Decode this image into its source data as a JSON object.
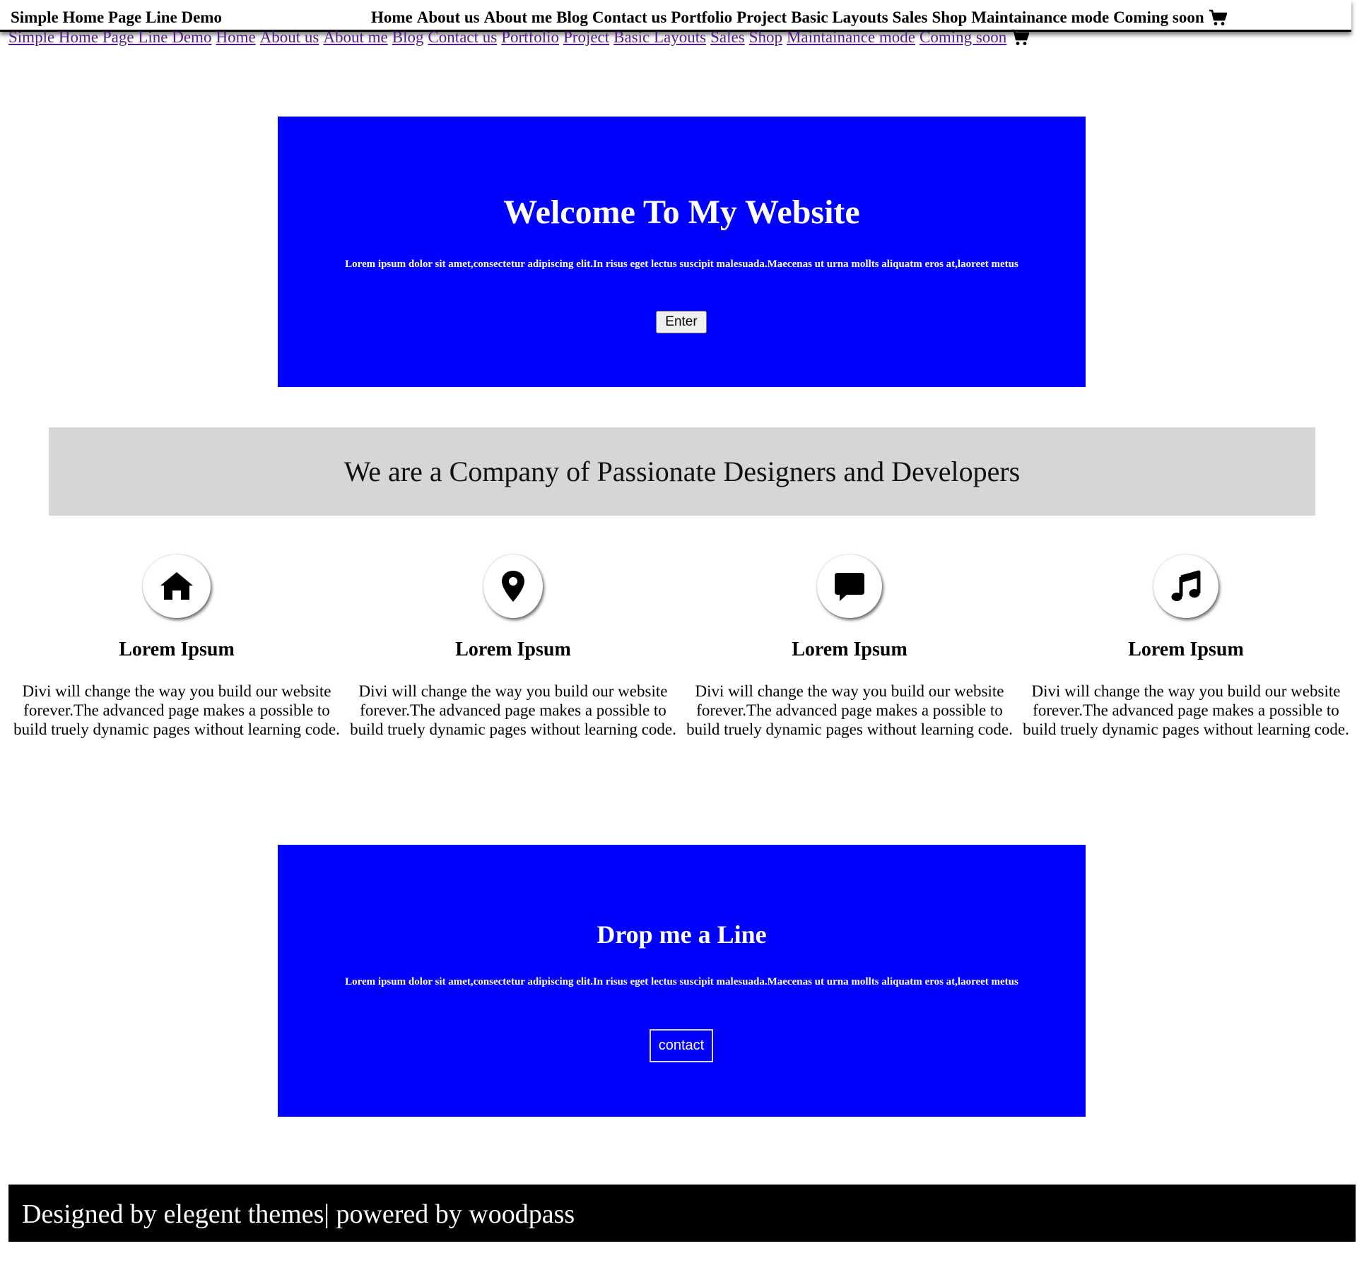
{
  "header": {
    "brand": "Simple Home Page Line Demo",
    "menu": [
      "Home",
      "About us",
      "About me",
      "Blog",
      "Contact us",
      "Portfolio",
      "Project",
      "Basic Layouts",
      "Sales",
      "Shop",
      "Maintainance mode",
      "Coming soon"
    ],
    "cart_icon": "cart-icon"
  },
  "linkrow": {
    "brand": "Simple Home Page Line Demo",
    "links": [
      "Home",
      "About us",
      "About me",
      "Blog",
      "Contact us",
      "Portfolio",
      "Project",
      "Basic Layouts",
      "Sales",
      "Shop",
      "Maintainance mode",
      "Coming soon"
    ],
    "cart_icon": "cart-icon"
  },
  "hero": {
    "title": "Welcome To My Website",
    "text": "Lorem ipsum dolor sit amet,consectetur adipiscing elit.In risus eget lectus suscipit malesuada.Maecenas ut urna mollts aliquatm eros at,laoreet metus",
    "button": "Enter",
    "background": "#0000ff"
  },
  "banner": {
    "title": "We are a Company of Passionate Designers and Developers",
    "background": "#d6d6d4"
  },
  "features": [
    {
      "icon": "home-icon",
      "title": "Lorem Ipsum",
      "text": "Divi will change the way you build our website forever.The advanced page makes a possible to build truely dynamic pages without learning code."
    },
    {
      "icon": "location-pin-icon",
      "title": "Lorem Ipsum",
      "text": "Divi will change the way you build our website forever.The advanced page makes a possible to build truely dynamic pages without learning code."
    },
    {
      "icon": "chat-bubble-icon",
      "title": "Lorem Ipsum",
      "text": "Divi will change the way you build our website forever.The advanced page makes a possible to build truely dynamic pages without learning code."
    },
    {
      "icon": "music-note-icon",
      "title": "Lorem Ipsum",
      "text": "Divi will change the way you build our website forever.The advanced page makes a possible to build truely dynamic pages without learning code."
    }
  ],
  "contact": {
    "title": "Drop me a Line",
    "text": "Lorem ipsum dolor sit amet,consectetur adipiscing elit.In risus eget lectus suscipit malesuada.Maecenas ut urna mollts aliquatm eros at,laoreet metus",
    "button": "contact"
  },
  "footer": {
    "text": "Designed by elegent themes| powered by woodpass",
    "background": "#000000"
  }
}
